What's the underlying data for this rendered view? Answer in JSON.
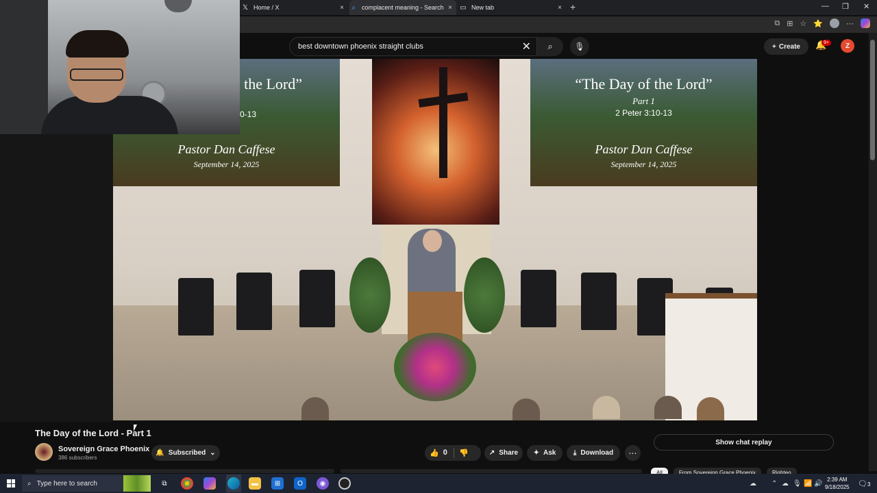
{
  "browser": {
    "tabs": [
      {
        "label": "Home / X",
        "icon": "x-logo-icon"
      },
      {
        "label": "complacent meaning - Search",
        "icon": "search-icon"
      },
      {
        "label": "New tab",
        "icon": "newtab-icon"
      }
    ],
    "close_glyph": "×",
    "new_tab_glyph": "+"
  },
  "youtube": {
    "search_value": "best downtown phoenix straight clubs",
    "create_label": "Create",
    "notif_badge": "9+",
    "user_initial": "Z"
  },
  "slide": {
    "left_title": "the Lord”",
    "left_ref": "0-13",
    "left_pastor": "Pastor Dan Caffese",
    "left_date": "September 14, 2025",
    "right_title": "“The Day of the Lord”",
    "right_part": "Part 1",
    "right_ref": "2 Peter 3:10-13",
    "right_pastor": "Pastor Dan Caffese",
    "right_date": "September 14, 2025"
  },
  "video": {
    "title": "The Day of the Lord - Part 1",
    "channel": "Sovereign Grace Phoenix",
    "subscribers": "386 subscribers",
    "subscribed_label": "Subscribed",
    "likes": "0",
    "share_label": "Share",
    "ask_label": "Ask",
    "download_label": "Download",
    "chat_replay_label": "Show chat replay"
  },
  "chips": [
    "All",
    "From Sovereign Grace Phoenix",
    "Righteo"
  ],
  "taskbar": {
    "search_placeholder": "Type here to search",
    "time": "2:39 AM",
    "date": "9/18/2025",
    "notif_count": "3"
  }
}
